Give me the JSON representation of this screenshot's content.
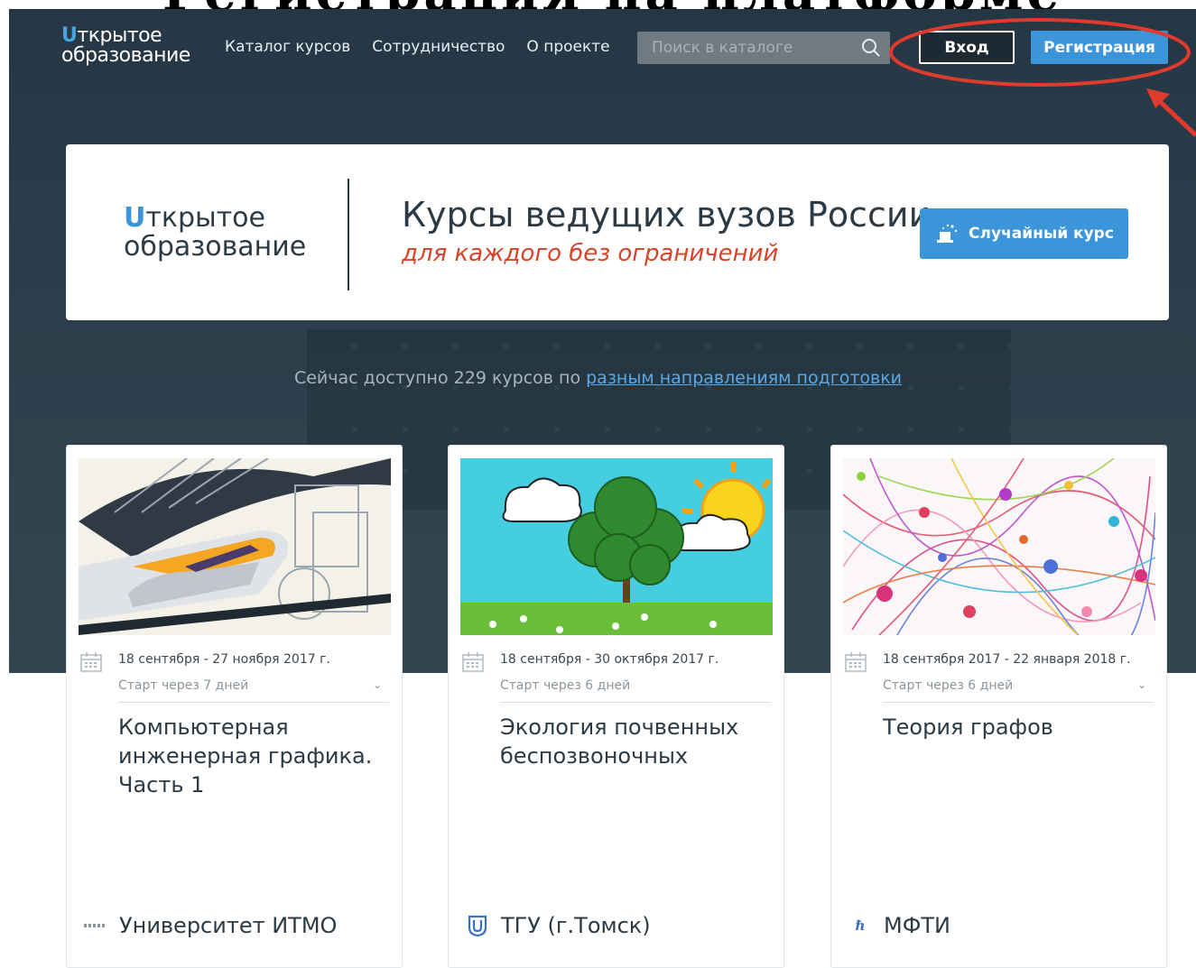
{
  "slide_heading": "Регистрация на платформе",
  "header": {
    "logo_line1": "ткрытое",
    "logo_line2": "образование",
    "nav": [
      "Каталог курсов",
      "Сотрудничество",
      "О проекте"
    ],
    "search_placeholder": "Поиск в каталоге",
    "login_label": "Вход",
    "register_label": "Регистрация"
  },
  "banner": {
    "logo_line1": "ткрытое",
    "logo_line2": "образование",
    "title": "Курсы ведущих вузов России",
    "subtitle": "для каждого без ограничений",
    "random_button": "Случайный курс"
  },
  "available": {
    "prefix": "Сейчас доступно 229 курсов по ",
    "link": "разным направлениям подготовки"
  },
  "courses": [
    {
      "dates": "18 сентября - 27 ноября 2017 г.",
      "start": "Старт через 7 дней",
      "title": "Компьютерная инженерная графика. Часть 1",
      "university": "Университет ИТМО",
      "image": "high-speed-train-illustration"
    },
    {
      "dates": "18 сентября - 30 октября 2017 г.",
      "start": "Старт через 6 дней",
      "title": "Экология почвенных беспозвоночных",
      "university": "ТГУ (г.Томск)",
      "image": "tree-sun-clouds-illustration"
    },
    {
      "dates": "18 сентября 2017 - 22 января 2018 г.",
      "start": "Старт через 6 дней",
      "title": "Теория графов",
      "university": "МФТИ",
      "image": "colorful-graph-network-illustration"
    }
  ],
  "colors": {
    "accent": "#3b95d8",
    "hero_bg": "#2b3f4c",
    "subtitle_red": "#d8432a",
    "annotation_red": "#e03a2f"
  }
}
